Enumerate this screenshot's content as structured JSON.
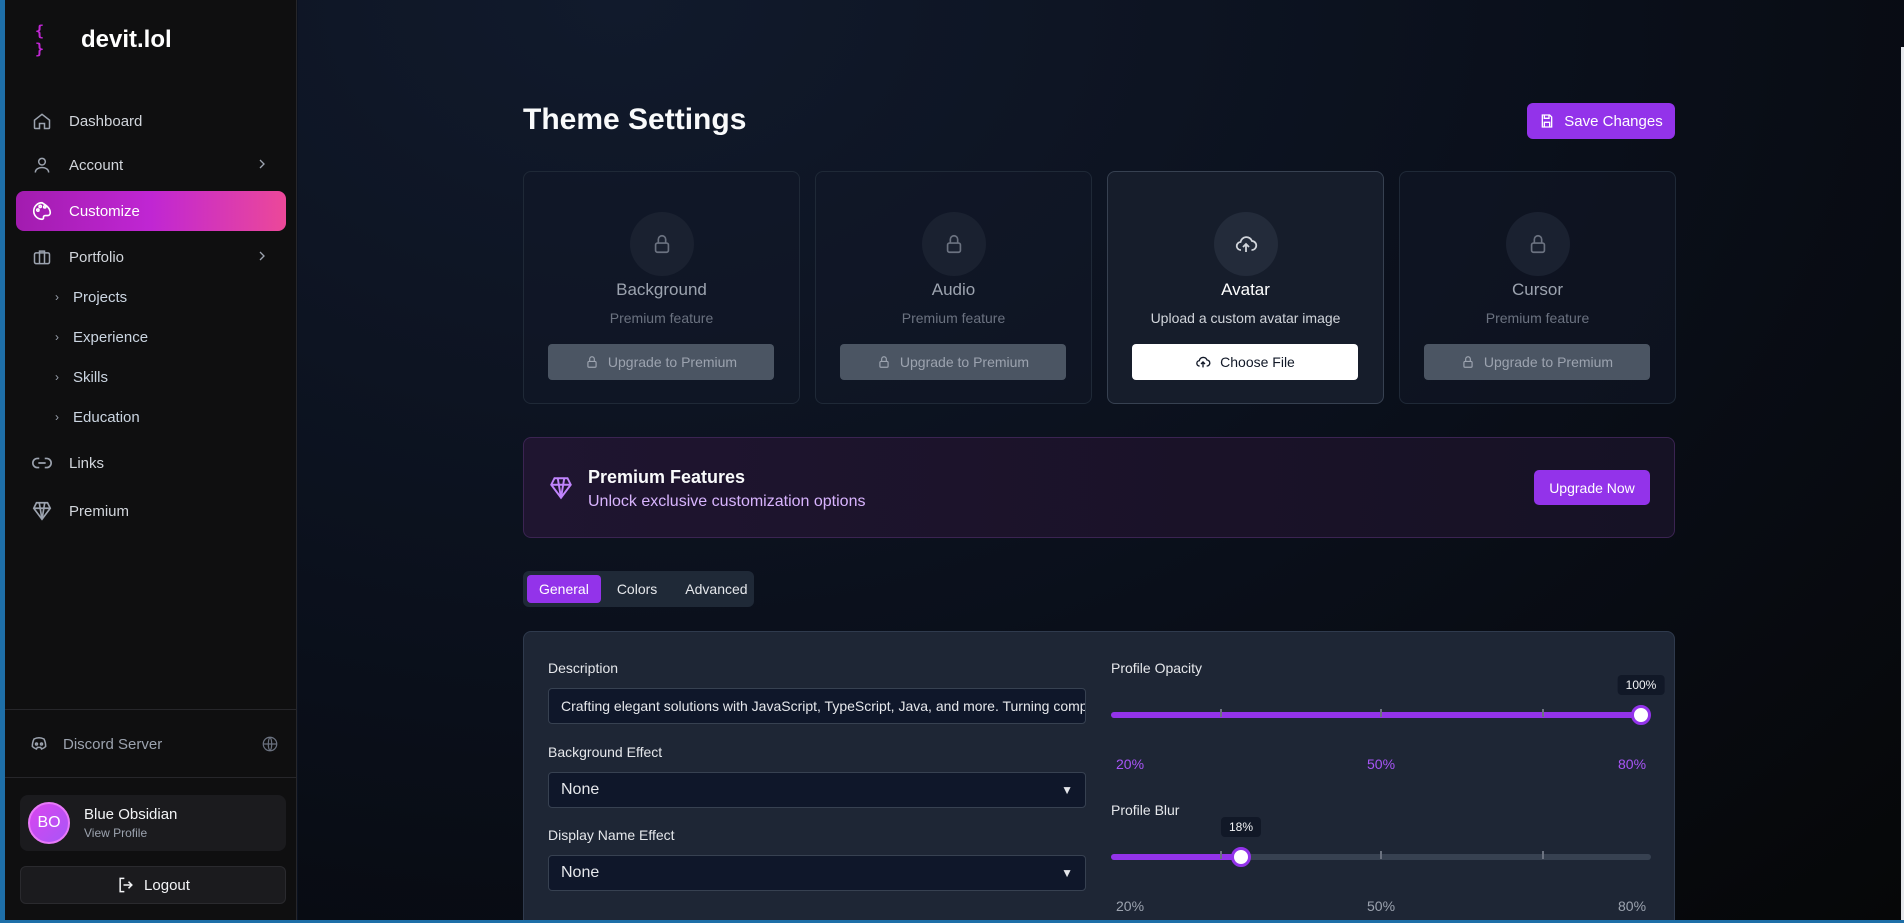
{
  "brand": {
    "icon": "{ }",
    "name": "devit.lol"
  },
  "nav": {
    "dashboard": "Dashboard",
    "account": "Account",
    "customize": "Customize",
    "portfolio": "Portfolio",
    "portfolio_items": [
      "Projects",
      "Experience",
      "Skills",
      "Education"
    ],
    "links": "Links",
    "premium": "Premium",
    "discord": "Discord Server"
  },
  "user": {
    "initials": "BO",
    "name": "Blue Obsidian",
    "link": "View Profile",
    "logout": "Logout"
  },
  "page": {
    "title": "Theme Settings",
    "save_label": "Save Changes"
  },
  "cards": [
    {
      "title": "Background",
      "subtitle": "Premium feature",
      "button": "Upgrade to Premium",
      "icon": "lock-icon",
      "enabled": false
    },
    {
      "title": "Audio",
      "subtitle": "Premium feature",
      "button": "Upgrade to Premium",
      "icon": "lock-icon",
      "enabled": false
    },
    {
      "title": "Avatar",
      "subtitle": "Upload a custom avatar image",
      "button": "Choose File",
      "icon": "upload-cloud-icon",
      "enabled": true
    },
    {
      "title": "Cursor",
      "subtitle": "Premium feature",
      "button": "Upgrade to Premium",
      "icon": "lock-icon",
      "enabled": false
    }
  ],
  "premium_banner": {
    "title": "Premium Features",
    "subtitle": "Unlock exclusive customization options",
    "button": "Upgrade Now"
  },
  "tabs": [
    "General",
    "Colors",
    "Advanced"
  ],
  "active_tab": "General",
  "form": {
    "description_label": "Description",
    "description_value": "Crafting elegant solutions with JavaScript, TypeScript, Java, and more. Turning complex problems into clean code.",
    "bg_effect_label": "Background Effect",
    "bg_effect_value": "None",
    "name_effect_label": "Display Name Effect",
    "name_effect_value": "None",
    "opacity_label": "Profile Opacity",
    "opacity_value": 100,
    "opacity_tip": "100%",
    "blur_label": "Profile Blur",
    "blur_value": 18,
    "blur_tip": "18%",
    "scale_labels": [
      "20%",
      "50%",
      "80%"
    ]
  },
  "colors": {
    "accent": "#9333ea",
    "gradient_start": "#a21caf",
    "gradient_end": "#ec4899"
  }
}
